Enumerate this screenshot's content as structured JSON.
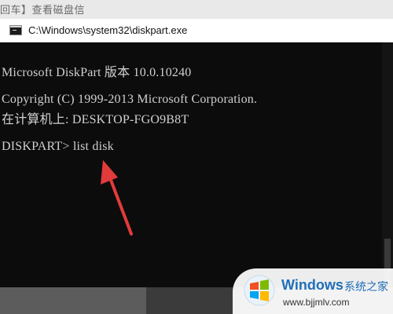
{
  "header_caption": "回车】查看磁盘信",
  "window": {
    "title": "C:\\Windows\\system32\\diskpart.exe"
  },
  "console": {
    "lines": [
      "Microsoft DiskPart 版本 10.0.10240",
      "Copyright (C) 1999-2013 Microsoft Corporation.",
      "在计算机上: DESKTOP-FGO9B8T",
      "DISKPART> list disk"
    ]
  },
  "watermark": {
    "brand": "Windows",
    "brand_cn": "系统之家",
    "url": "www.bjjmlv.com"
  },
  "colors": {
    "console_bg": "#0c0c0c",
    "console_text": "#d0d0d0",
    "arrow": "#e23b3b",
    "brand_blue": "#1f6fb8"
  },
  "icons": [
    "console-window-icon",
    "red-arrow-pointer",
    "windows-logo-icon"
  ]
}
